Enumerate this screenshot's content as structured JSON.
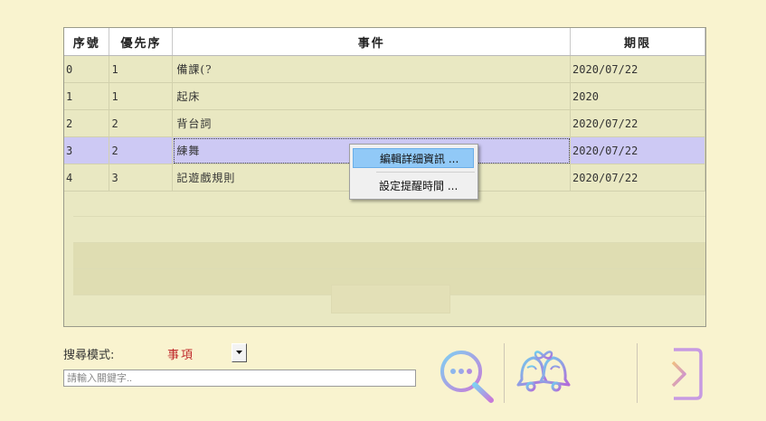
{
  "table": {
    "headers": [
      "序號",
      "優先序",
      "事件",
      "期限"
    ],
    "rows": [
      [
        "0",
        "1",
        "備課(?",
        "2020/07/22"
      ],
      [
        "1",
        "1",
        "起床",
        "2020"
      ],
      [
        "2",
        "2",
        "背台詞",
        "2020/07/22"
      ],
      [
        "3",
        "2",
        "練舞",
        "2020/07/22"
      ],
      [
        "4",
        "3",
        "記遊戲規則",
        "2020/07/22"
      ]
    ],
    "selected_index": 3
  },
  "context_menu": {
    "items": [
      "編輯詳細資訊 ...",
      "設定提醒時間 ..."
    ]
  },
  "search": {
    "mode_label": "搜尋模式:",
    "mode_value": "事項",
    "placeholder": "請輸入關鍵字.."
  },
  "icons": {
    "search": "search-chat-icon",
    "bells": "wedding-bells-icon",
    "exit": "login-arrow-icon"
  },
  "colors": {
    "selected_row": "#cdc9f4",
    "menu_highlight": "#91c9f7",
    "accent_gradient_start": "#7fd0f2",
    "accent_gradient_end": "#c77ad8"
  }
}
